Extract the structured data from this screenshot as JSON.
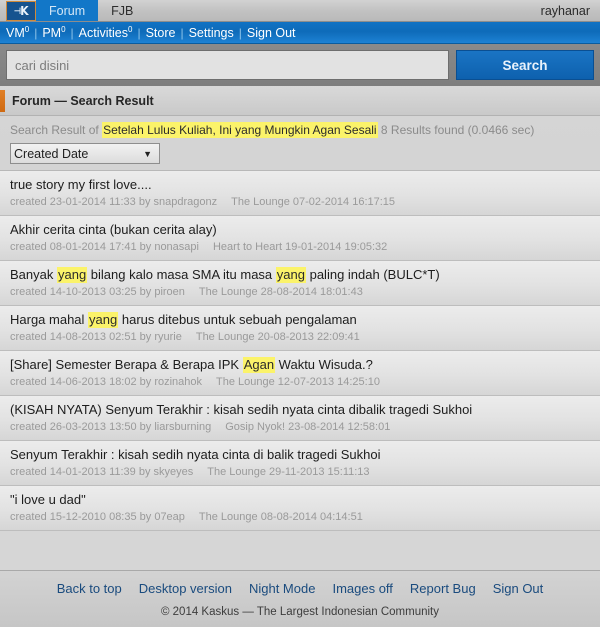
{
  "topbar": {
    "logo_icon": "kaskus-k-logo-icon",
    "tabs": [
      {
        "label": "Forum",
        "active": true
      },
      {
        "label": "FJB",
        "active": false
      }
    ],
    "username": "rayhanar"
  },
  "navbar": {
    "items": [
      {
        "label": "VM",
        "badge": "0"
      },
      {
        "label": "PM",
        "badge": "0"
      },
      {
        "label": "Activities",
        "badge": "0"
      },
      {
        "label": "Store",
        "badge": ""
      },
      {
        "label": "Settings",
        "badge": ""
      },
      {
        "label": "Sign Out",
        "badge": ""
      }
    ],
    "separator": "|"
  },
  "search": {
    "placeholder": "cari disini",
    "value": "",
    "button_label": "Search"
  },
  "section": {
    "title": "Forum — Search Result",
    "accent_color": "#d8751c"
  },
  "result_meta": {
    "prefix": "Search Result of",
    "query": "Setelah Lulus Kuliah, Ini yang Mungkin Agan Sesali",
    "summary": "8 Results found (0.0466 sec)",
    "highlight_color": "#fbf36a"
  },
  "sort": {
    "selected": "Created Date",
    "options": [
      "Created Date"
    ],
    "caret_icon": "chevron-down-icon"
  },
  "results": [
    {
      "title_parts": [
        {
          "text": "true story my first love....",
          "highlight": false
        }
      ],
      "created_label": "created",
      "created_date": "23-01-2014 11:33",
      "by_label": "by",
      "author": "snapdragonz",
      "forum": "The Lounge",
      "last_post": "07-02-2014 16:17:15"
    },
    {
      "title_parts": [
        {
          "text": "Akhir cerita cinta (bukan cerita alay)",
          "highlight": false
        }
      ],
      "created_label": "created",
      "created_date": "08-01-2014 17:41",
      "by_label": "by",
      "author": "nonasapi",
      "forum": "Heart to Heart",
      "last_post": "19-01-2014 19:05:32"
    },
    {
      "title_parts": [
        {
          "text": "Banyak ",
          "highlight": false
        },
        {
          "text": "yang",
          "highlight": true
        },
        {
          "text": " bilang kalo masa SMA itu masa ",
          "highlight": false
        },
        {
          "text": "yang",
          "highlight": true
        },
        {
          "text": " paling indah (BULC*T)",
          "highlight": false
        }
      ],
      "created_label": "created",
      "created_date": "14-10-2013 03:25",
      "by_label": "by",
      "author": "piroen",
      "forum": "The Lounge",
      "last_post": "28-08-2014 18:01:43"
    },
    {
      "title_parts": [
        {
          "text": "Harga mahal ",
          "highlight": false
        },
        {
          "text": "yang",
          "highlight": true
        },
        {
          "text": " harus ditebus untuk sebuah pengalaman",
          "highlight": false
        }
      ],
      "created_label": "created",
      "created_date": "14-08-2013 02:51",
      "by_label": "by",
      "author": "ryurie",
      "forum": "The Lounge",
      "last_post": "20-08-2013 22:09:41"
    },
    {
      "title_parts": [
        {
          "text": "[Share] Semester Berapa & Berapa IPK ",
          "highlight": false
        },
        {
          "text": "Agan",
          "highlight": true
        },
        {
          "text": " Waktu Wisuda.?",
          "highlight": false
        }
      ],
      "created_label": "created",
      "created_date": "14-06-2013 18:02",
      "by_label": "by",
      "author": "rozinahok",
      "forum": "The Lounge",
      "last_post": "12-07-2013 14:25:10"
    },
    {
      "title_parts": [
        {
          "text": "(KISAH NYATA) Senyum Terakhir : kisah sedih nyata cinta dibalik tragedi Sukhoi",
          "highlight": false
        }
      ],
      "created_label": "created",
      "created_date": "26-03-2013 13:50",
      "by_label": "by",
      "author": "liarsburning",
      "forum": "Gosip Nyok!",
      "last_post": "23-08-2014 12:58:01"
    },
    {
      "title_parts": [
        {
          "text": "Senyum Terakhir : kisah sedih nyata cinta di balik tragedi Sukhoi",
          "highlight": false
        }
      ],
      "created_label": "created",
      "created_date": "14-01-2013 11:39",
      "by_label": "by",
      "author": "skyeyes",
      "forum": "The Lounge",
      "last_post": "29-11-2013 15:11:13"
    },
    {
      "title_parts": [
        {
          "text": "\"i love u dad\"",
          "highlight": false
        }
      ],
      "created_label": "created",
      "created_date": "15-12-2010 08:35",
      "by_label": "by",
      "author": "07eap",
      "forum": "The Lounge",
      "last_post": "08-08-2014 04:14:51"
    }
  ],
  "footer": {
    "links": [
      "Back to top",
      "Desktop version",
      "Night Mode",
      "Images off",
      "Report Bug",
      "Sign Out"
    ],
    "copyright": "© 2014 Kaskus — The Largest Indonesian Community"
  }
}
